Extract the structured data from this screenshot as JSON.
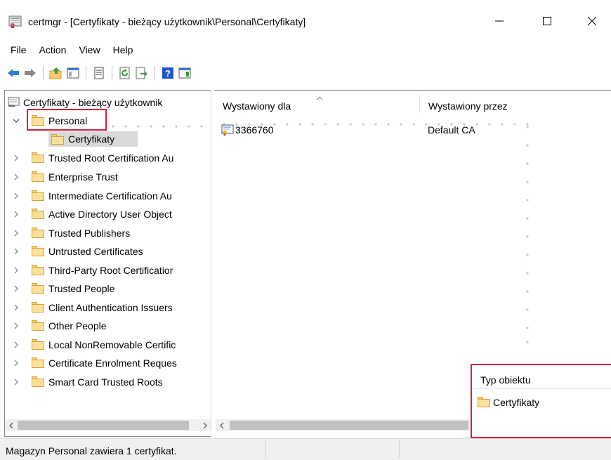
{
  "window": {
    "title": "certmgr - [Certyfikaty - bieżący użytkownik\\Personal\\Certyfikaty]",
    "minimize_glyph": "—",
    "maximize_glyph": "☐",
    "close_glyph": "✕"
  },
  "menu": {
    "items": [
      "File",
      "Action",
      "View",
      "Help"
    ]
  },
  "toolbar": {
    "buttons": [
      "back-icon",
      "forward-icon",
      "up-folder-icon",
      "show-hide-tree-icon",
      "properties-icon",
      "refresh-icon",
      "export-list-icon",
      "help-icon",
      "action-pane-icon"
    ]
  },
  "tree": {
    "root_label": "Certyfikaty - bieżący użytkownik",
    "personal_label": "Personal",
    "personal_child_label": "Certyfikaty",
    "items": [
      "Trusted Root Certification Au",
      "Enterprise Trust",
      "Intermediate Certification Au",
      "Active Directory User Object",
      "Trusted Publishers",
      "Untrusted Certificates",
      "Third-Party Root Certificatior",
      "Trusted People",
      "Client Authentication Issuers",
      "Other People",
      "Local NonRemovable Certific",
      "Certificate Enrolment Reques",
      "Smart Card Trusted Roots"
    ]
  },
  "list": {
    "columns": [
      "Wystawiony dla",
      "Wystawiony przez"
    ],
    "rows": [
      {
        "issued_to": "3366760",
        "issued_by": "Default CA"
      }
    ]
  },
  "object_type": {
    "header": "Typ obiektu",
    "item": "Certyfikaty"
  },
  "status": {
    "text": "Magazyn Personal zawiera 1 certyfikat."
  },
  "colors": {
    "highlight_border": "#d21f3c",
    "selection_bg": "#d9d9d9",
    "folder_fill": "#fbe09a"
  }
}
